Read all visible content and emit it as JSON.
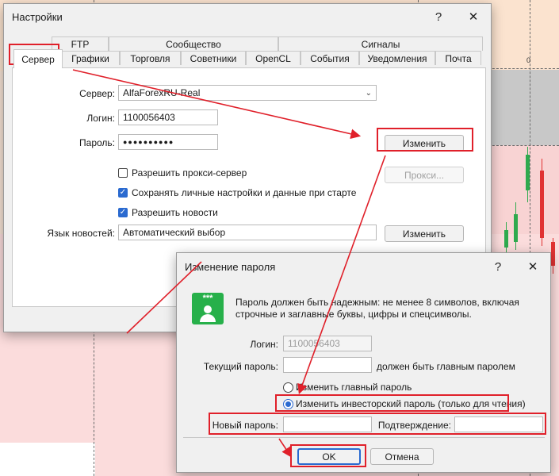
{
  "settings": {
    "title": "Настройки",
    "help": "?",
    "close": "✕",
    "tabs_top": [
      "FTP",
      "Сообщество",
      "Сигналы"
    ],
    "tabs_bottom": [
      "Графики",
      "Торговля",
      "Советники",
      "OpenCL",
      "События",
      "Уведомления",
      "Почта"
    ],
    "active_tab": "Сервер",
    "server_label": "Сервер:",
    "server_value": "AlfaForexRU-Real",
    "login_label": "Логин:",
    "login_value": "1100056403",
    "password_label": "Пароль:",
    "password_value": "●●●●●●●●●●",
    "change_button": "Изменить",
    "proxy_enable": "Разрешить прокси-сервер",
    "save_personal": "Сохранять личные настройки и данные при старте",
    "enable_news": "Разрешить новости",
    "proxy_button": "Прокси...",
    "news_lang_label": "Язык новостей:",
    "news_lang_value": "Автоматический выбор",
    "news_change_button": "Изменить"
  },
  "password_dialog": {
    "title": "Изменение пароля",
    "help": "?",
    "close": "✕",
    "icon_stars": "***",
    "info": "Пароль должен быть надежным: не менее 8 символов, включая строчные и заглавные буквы, цифры и спецсимволы.",
    "login_label": "Логин:",
    "login_value": "1100056403",
    "current_label": "Текущий пароль:",
    "current_hint": "должен быть главным паролем",
    "radio_main": "Изменить главный пароль",
    "radio_investor": "Изменить инвесторский пароль (только для чтения)",
    "new_label": "Новый пароль:",
    "confirm_label": "Подтверждение:",
    "ok": "OK",
    "cancel": "Отмена"
  },
  "chart": {
    "zero_label": "0"
  },
  "colors": {
    "accent": "#2a6ad0",
    "highlight": "#e0202a",
    "bull": "#2faa4e",
    "bear": "#e03232"
  }
}
